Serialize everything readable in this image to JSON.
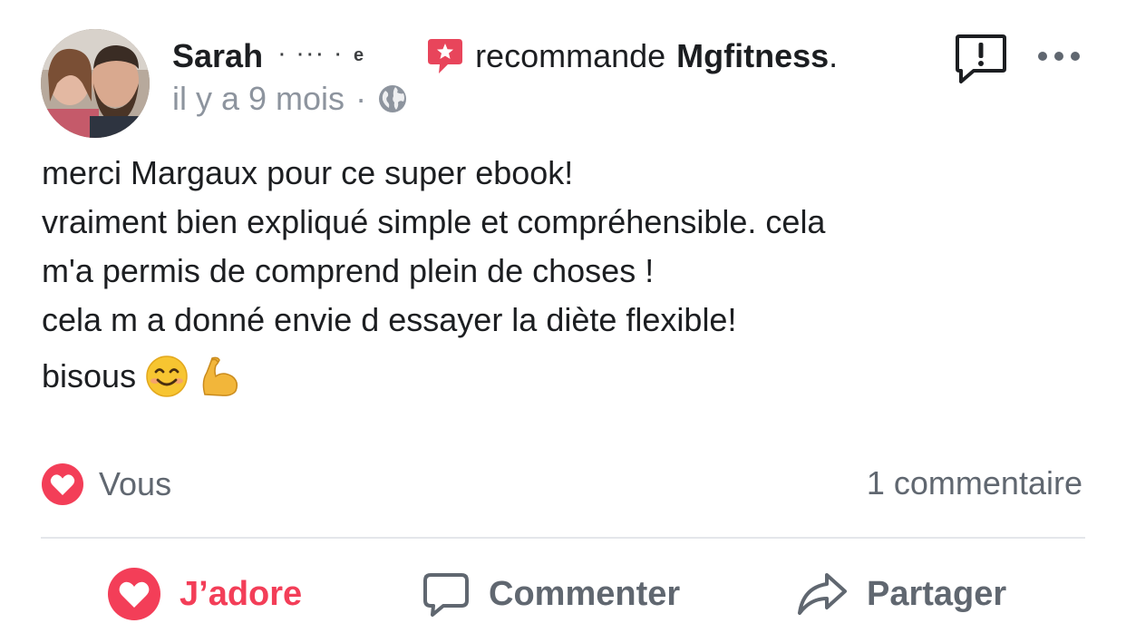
{
  "post": {
    "author": "Sarah",
    "author_redacted": "· ··· ·  e",
    "recommends_text": "recommande",
    "page_name": "Mgfitness",
    "page_name_suffix": ".",
    "time": "il y a 9 mois",
    "separator": "·",
    "audience_icon": "globe-icon",
    "recommend_icon": "recommend-star-bubble-icon",
    "body_lines": [
      "merci Margaux pour ce super ebook!",
      "vraiment bien expliqué simple et compréhensible. cela",
      "m'a permis de comprend plein de choses !",
      "cela m a donné envie d essayer la diète flexible!"
    ],
    "closing_text": "bisous",
    "closing_emojis": [
      "smiling-face-emoji",
      "flexed-biceps-emoji"
    ]
  },
  "reactions": {
    "icon": "love-reaction-icon",
    "label": "Vous"
  },
  "comments": {
    "count_label": "1 commentaire"
  },
  "actions": {
    "love_label": "J’adore",
    "comment_label": "Commenter",
    "share_label": "Partager"
  },
  "colors": {
    "love_red": "#f33e58",
    "recommend_red": "#e8455b",
    "secondary_text": "#606770",
    "meta_text": "#8d949e",
    "divider": "#e4e6eb"
  }
}
